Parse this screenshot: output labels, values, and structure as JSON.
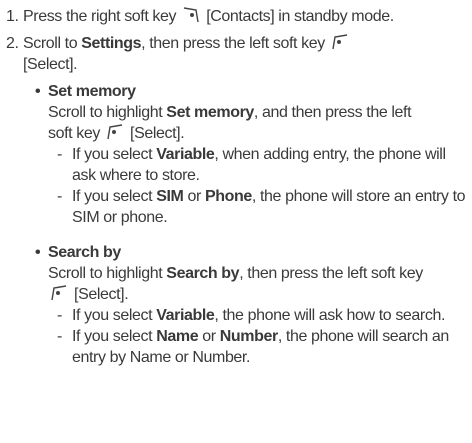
{
  "steps": [
    {
      "num": "1.",
      "p1": "Press the right soft key",
      "p2": "[Contacts] in standby mode."
    },
    {
      "num": "2.",
      "p1": "Scroll to",
      "bold": "Settings",
      "p2": ", then press the left soft key",
      "p3": "[Select]."
    }
  ],
  "set_memory": {
    "title": "Set memory",
    "desc_a": "Scroll to highlight",
    "desc_bold": "Set memory",
    "desc_b": ", and then press the left",
    "desc_c": "soft key",
    "desc_d": "[Select].",
    "dash1": {
      "a": "If you select",
      "b1": "Variable",
      "c": ", when adding entry, the phone will ask where to store."
    },
    "dash2": {
      "a": "If you select",
      "b1": "SIM",
      "or": "or",
      "b2": "Phone",
      "c": ", the phone will store an entry to SIM or phone."
    }
  },
  "search_by": {
    "title": "Search by",
    "desc_a": "Scroll to highlight",
    "desc_bold": "Search by",
    "desc_b": ", then press the left soft key",
    "desc_c": "[Select].",
    "dash1": {
      "a": "If you select",
      "b1": "Variable",
      "c": ", the phone will ask how to search."
    },
    "dash2": {
      "a": "If you select",
      "b1": "Name",
      "or": "or",
      "b2": "Number",
      "c": ", the phone will search an entry by Name or Number."
    }
  },
  "symbols": {
    "bullet": "•",
    "dash": "-"
  },
  "icons": {
    "right_soft_key": "right-soft-key-icon",
    "left_soft_key": "left-soft-key-icon"
  }
}
